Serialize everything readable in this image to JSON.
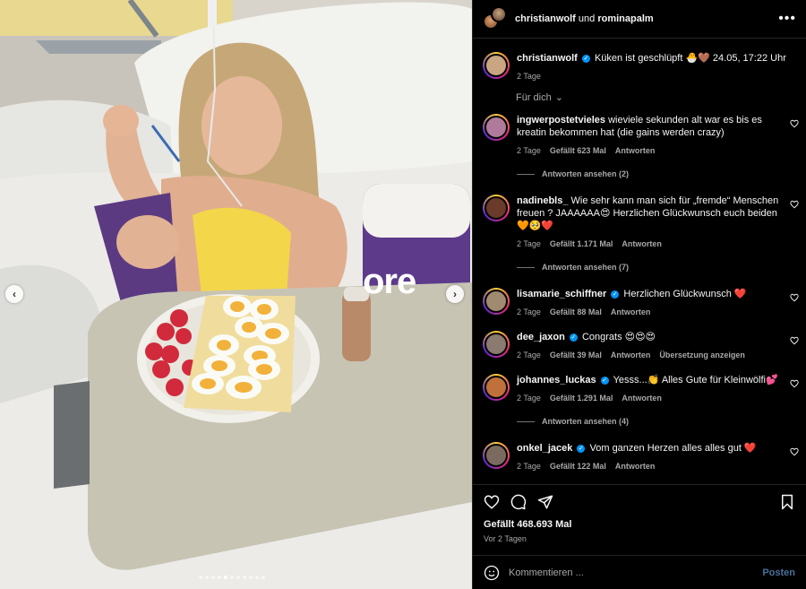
{
  "header": {
    "user1": "christianwolf",
    "joiner": "und",
    "user2": "rominapalm",
    "more": "•••"
  },
  "media": {
    "brand_text": "ore",
    "brand_small": "ore",
    "carousel_total": 11,
    "carousel_active": 4
  },
  "caption": {
    "username": "christianwolf",
    "text": "Küken ist geschlüpft 🐣🤎 24.05, 17:22 Uhr",
    "age": "2 Tage"
  },
  "filter_label": "Für dich",
  "comments": [
    {
      "username": "ingwerpostetvieles",
      "verified": false,
      "text": "wieviele sekunden alt war es bis es kreatin bekommen hat (die gains werden crazy)",
      "age": "2 Tage",
      "likes": "Gefällt 623 Mal",
      "reply": "Antworten",
      "translate": "",
      "replies": "Antworten ansehen (2)",
      "avatar_color": "#b07a9a"
    },
    {
      "username": "nadinebls_",
      "verified": false,
      "text": "Wie sehr kann man sich für „fremde“ Menschen freuen ? JAAAAAA😍 Herzlichen Glückwunsch euch beiden 🧡🥺❤️",
      "age": "2 Tage",
      "likes": "Gefällt 1.171 Mal",
      "reply": "Antworten",
      "translate": "",
      "replies": "Antworten ansehen (7)",
      "avatar_color": "#6a3a2a"
    },
    {
      "username": "lisamarie_schiffner",
      "verified": true,
      "text": "Herzlichen Glückwunsch ❤️",
      "age": "2 Tage",
      "likes": "Gefällt 88 Mal",
      "reply": "Antworten",
      "translate": "",
      "replies": "",
      "avatar_color": "#a08a70"
    },
    {
      "username": "dee_jaxon",
      "verified": true,
      "text": "Congrats 😍😍😍",
      "age": "2 Tage",
      "likes": "Gefällt 39 Mal",
      "reply": "Antworten",
      "translate": "Übersetzung anzeigen",
      "replies": "",
      "avatar_color": "#8a7a70"
    },
    {
      "username": "johannes_luckas",
      "verified": true,
      "text": "Yesss...👏 Alles Gute für Kleinwölfi💕",
      "age": "2 Tage",
      "likes": "Gefällt 1.291 Mal",
      "reply": "Antworten",
      "translate": "",
      "replies": "Antworten ansehen (4)",
      "avatar_color": "#c0703a"
    },
    {
      "username": "onkel_jacek",
      "verified": true,
      "text": "Vom ganzen Herzen alles alles gut ❤️",
      "age": "2 Tage",
      "likes": "Gefällt 122 Mal",
      "reply": "Antworten",
      "translate": "",
      "replies": "",
      "avatar_color": "#7a6a60"
    }
  ],
  "footer": {
    "likes": "Gefällt 468.693 Mal",
    "ago": "Vor 2 Tagen",
    "comment_placeholder": "Kommentieren ...",
    "post_label": "Posten"
  },
  "icons": {
    "like": "heart-icon",
    "comment": "comment-icon",
    "share": "share-icon",
    "save": "bookmark-icon",
    "emoji": "emoji-icon"
  },
  "colors": {
    "verified": "#0095f6",
    "post_disabled": "#4a6e9a",
    "background": "#000000"
  }
}
